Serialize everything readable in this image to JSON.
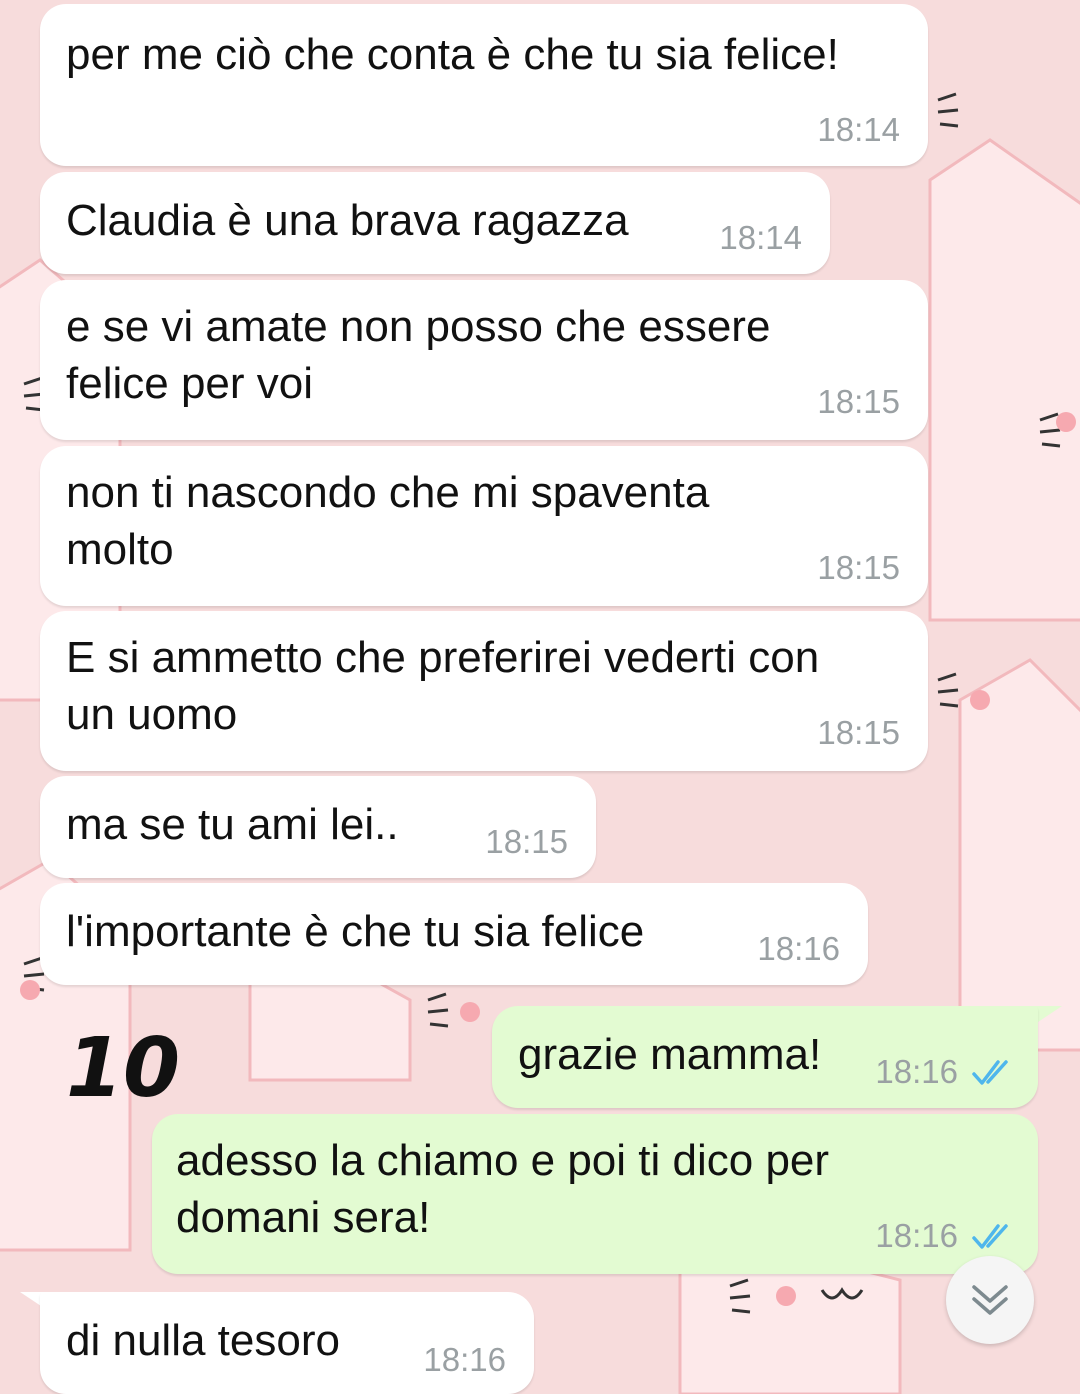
{
  "chat": {
    "messages": [
      {
        "text": "per me ciò che conta è che tu sia felice!",
        "time": "18:14",
        "direction": "incoming"
      },
      {
        "text": "Claudia è una brava ragazza",
        "time": "18:14",
        "direction": "incoming"
      },
      {
        "text": "e se vi amate non posso che essere\nfelice per voi",
        "time": "18:15",
        "direction": "incoming"
      },
      {
        "text": "non ti nascondo che mi spaventa\nmolto",
        "time": "18:15",
        "direction": "incoming"
      },
      {
        "text": "E si ammetto che preferirei vederti con\nun uomo",
        "time": "18:15",
        "direction": "incoming"
      },
      {
        "text": "ma se tu ami lei..",
        "time": "18:15",
        "direction": "incoming"
      },
      {
        "text": "l'importante è che tu sia felice",
        "time": "18:16",
        "direction": "incoming"
      },
      {
        "text": "grazie mamma!",
        "time": "18:16",
        "direction": "outgoing",
        "status": "read"
      },
      {
        "text": "adesso la chiamo e poi ti dico per\ndomani sera!",
        "time": "18:16",
        "direction": "outgoing",
        "status": "read"
      },
      {
        "text": "di nulla tesoro",
        "time": "18:16",
        "direction": "incoming"
      }
    ]
  },
  "annotation": {
    "text": "10"
  },
  "scroll_button": {
    "icon": "double-chevron-down-icon"
  },
  "colors": {
    "incoming_bubble": "#ffffff",
    "outgoing_bubble": "#e3fbd2",
    "read_ticks": "#4fb6ec",
    "wallpaper": "#f7dcdc",
    "timestamp": "#9aa0a3"
  }
}
